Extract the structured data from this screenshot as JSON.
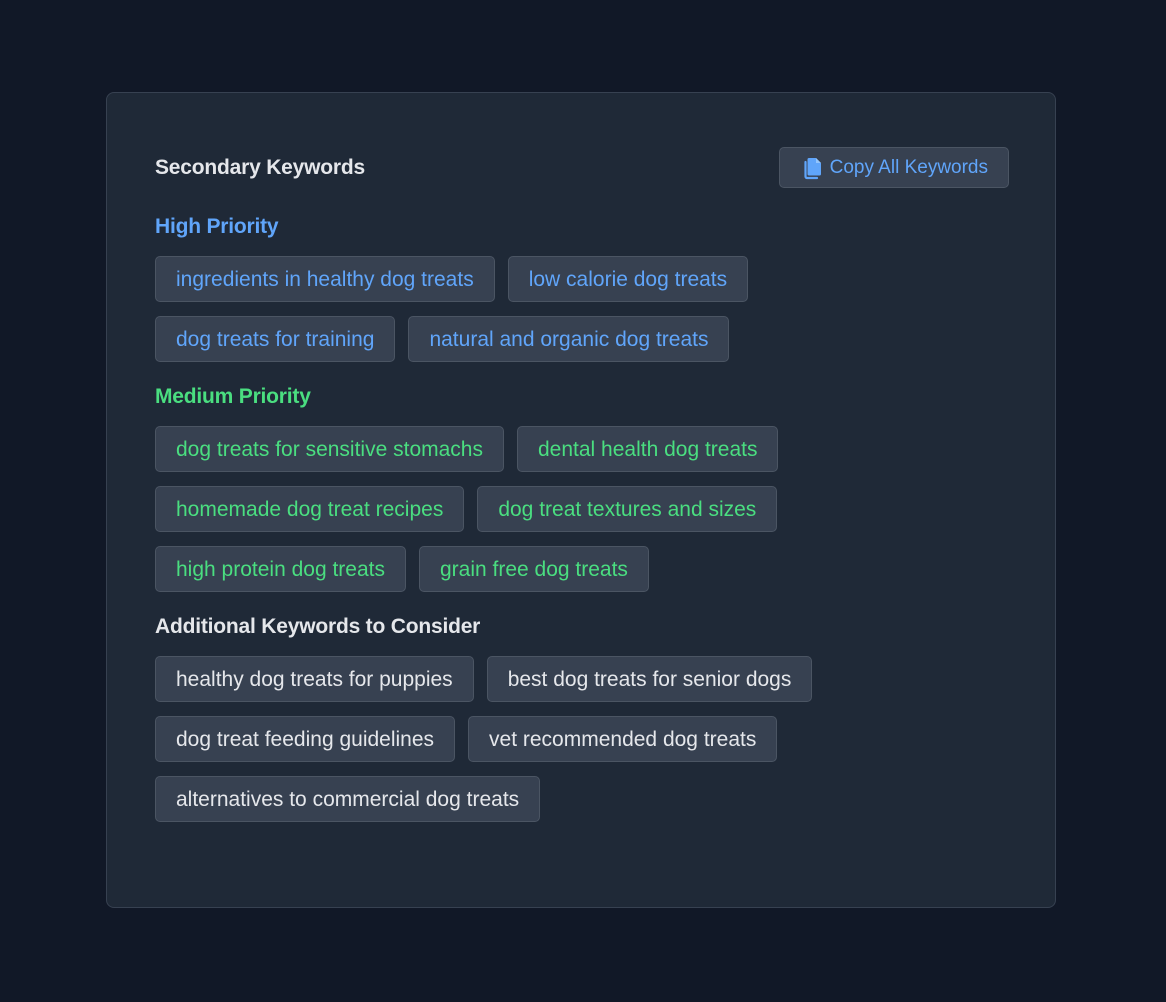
{
  "card": {
    "title": "Secondary Keywords",
    "copy_button_label": "Copy All Keywords",
    "copy_icon": "document-copy-icon"
  },
  "colors": {
    "background": "#111827",
    "card": "#1f2937",
    "chip": "#374151",
    "high": "#60a5fa",
    "medium": "#4ade80",
    "additional": "#e5e7eb"
  },
  "sections": [
    {
      "id": "high",
      "title": "High Priority",
      "color": "#60a5fa",
      "keywords": [
        "ingredients in healthy dog treats",
        "low calorie dog treats",
        "dog treats for training",
        "natural and organic dog treats"
      ]
    },
    {
      "id": "medium",
      "title": "Medium Priority",
      "color": "#4ade80",
      "keywords": [
        "dog treats for sensitive stomachs",
        "dental health dog treats",
        "homemade dog treat recipes",
        "dog treat textures and sizes",
        "high protein dog treats",
        "grain free dog treats"
      ]
    },
    {
      "id": "additional",
      "title": "Additional Keywords to Consider",
      "color": "#e5e7eb",
      "keywords": [
        "healthy dog treats for puppies",
        "best dog treats for senior dogs",
        "dog treat feeding guidelines",
        "vet recommended dog treats",
        "alternatives to commercial dog treats"
      ]
    }
  ]
}
